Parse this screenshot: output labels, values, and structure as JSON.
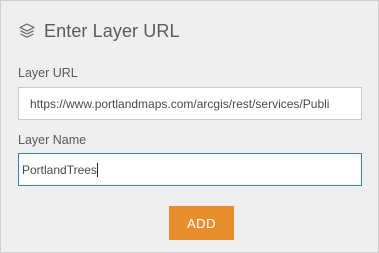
{
  "header": {
    "title": "Enter Layer URL",
    "icon": "layers-icon"
  },
  "form": {
    "url_label": "Layer URL",
    "url_value": "https://www.portlandmaps.com/arcgis/rest/services/Publi",
    "name_label": "Layer Name",
    "name_value": "PortlandTrees",
    "add_label": "ADD"
  },
  "colors": {
    "accent": "#e78f2f",
    "focus_border": "#3b7fc4",
    "panel_bg": "#efefef"
  }
}
